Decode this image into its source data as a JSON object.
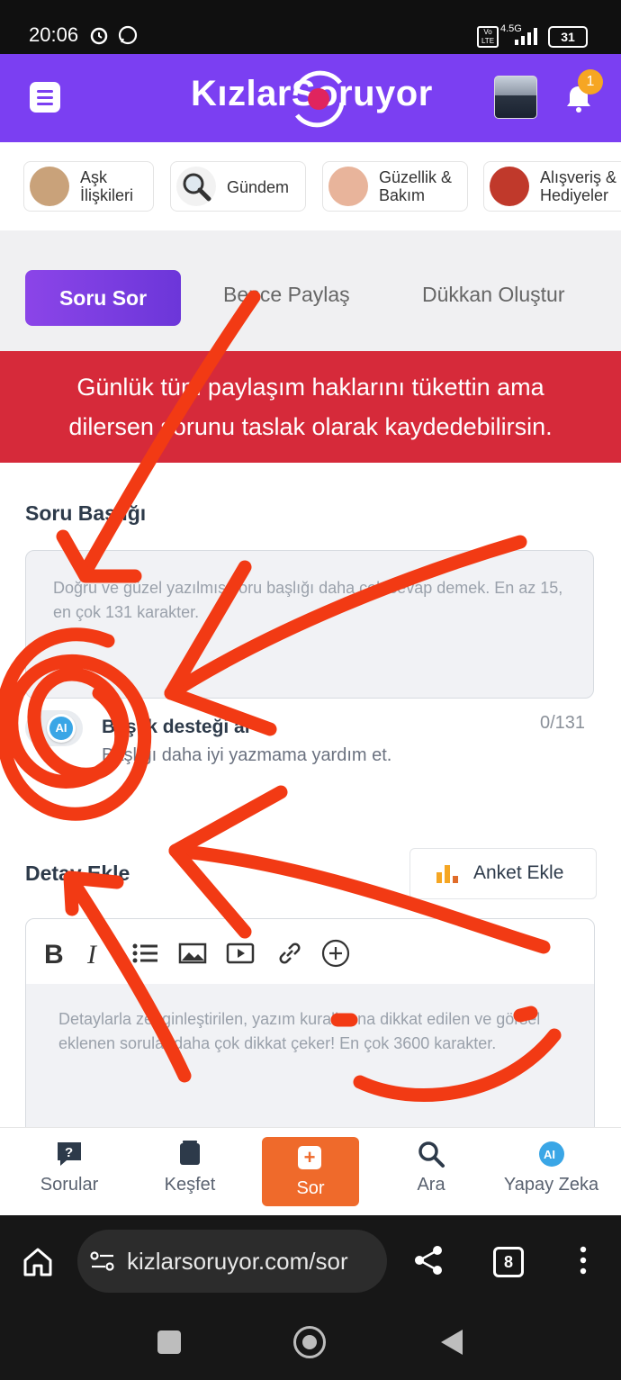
{
  "status_bar": {
    "time": "20:06",
    "network": "4.5G",
    "battery": "31"
  },
  "header": {
    "logo": "KızlarSoruyor",
    "notification_count": "1"
  },
  "categories": [
    {
      "label": "Aşk\nİlişkileri",
      "thumb_color": "#c9a27a"
    },
    {
      "label": "Gündem",
      "thumb_color": "#e8e8e8"
    },
    {
      "label": "Güzellik &\nBakım",
      "thumb_color": "#e8b49b"
    },
    {
      "label": "Alışveriş &\nHediyeler",
      "thumb_color": "#c0392b"
    }
  ],
  "tabs": {
    "ask": "Soru Sor",
    "share": "Bence Paylaş",
    "shop": "Dükkan Oluştur"
  },
  "alert": {
    "text": "Günlük tüm paylaşım haklarını tükettin ama dilersen sorunu taslak olarak kaydedebilirsin."
  },
  "form": {
    "title_label": "Soru Başlığı",
    "title_placeholder": "Doğru ve güzel yazılmış soru başlığı daha çok cevap demek. En az 15, en çok 131 karakter.",
    "ai_title": "Başlık desteği al",
    "ai_subtitle": "Başlığı daha iyi yazmama yardım et.",
    "counter": "0/131",
    "detail_label": "Detay Ekle",
    "poll_button": "Anket Ekle",
    "detail_placeholder": "Detaylarla zenginleştirilen, yazım kurallarına dikkat edilen ve görsel eklenen sorular daha çok dikkat çeker! En çok 3600 karakter."
  },
  "bottom_nav": {
    "questions": "Sorular",
    "explore": "Keşfet",
    "ask": "Sor",
    "search": "Ara",
    "ai": "Yapay Zeka"
  },
  "browser": {
    "url": "kizlarsoruyor.com/sor",
    "tab_count": "8"
  },
  "colors": {
    "brand_purple": "#7b3ff2",
    "alert_red": "#d62a3a",
    "ask_orange": "#ef6a2b",
    "annotation_red": "#f23a14"
  }
}
